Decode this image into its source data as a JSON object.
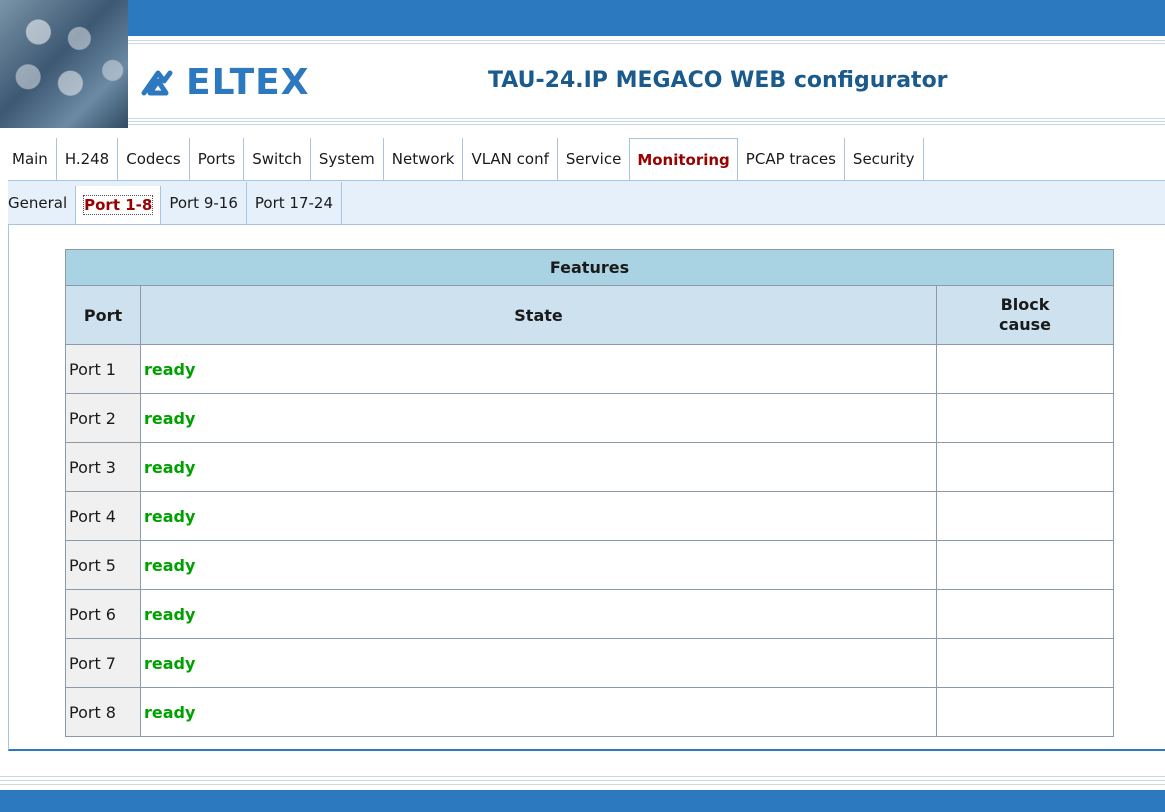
{
  "header": {
    "logo_text": "ELTEX",
    "app_title": "TAU-24.IP MEGACO WEB configurator"
  },
  "main_tabs": [
    {
      "label": "Main"
    },
    {
      "label": "H.248"
    },
    {
      "label": "Codecs"
    },
    {
      "label": "Ports"
    },
    {
      "label": "Switch"
    },
    {
      "label": "System"
    },
    {
      "label": "Network"
    },
    {
      "label": "VLAN conf"
    },
    {
      "label": "Service"
    },
    {
      "label": "Monitoring",
      "active": true
    },
    {
      "label": "PCAP traces"
    },
    {
      "label": "Security"
    }
  ],
  "sub_tabs": [
    {
      "label": "General"
    },
    {
      "label": "Port 1-8",
      "active": true
    },
    {
      "label": "Port 9-16"
    },
    {
      "label": "Port 17-24"
    }
  ],
  "table": {
    "caption": "Features",
    "headers": {
      "port": "Port",
      "state": "State",
      "block": "Block\ncause"
    },
    "rows": [
      {
        "port": "Port 1",
        "state": "ready",
        "block": ""
      },
      {
        "port": "Port 2",
        "state": "ready",
        "block": ""
      },
      {
        "port": "Port 3",
        "state": "ready",
        "block": ""
      },
      {
        "port": "Port 4",
        "state": "ready",
        "block": ""
      },
      {
        "port": "Port 5",
        "state": "ready",
        "block": ""
      },
      {
        "port": "Port 6",
        "state": "ready",
        "block": ""
      },
      {
        "port": "Port 7",
        "state": "ready",
        "block": ""
      },
      {
        "port": "Port 8",
        "state": "ready",
        "block": ""
      }
    ]
  },
  "colors": {
    "brand_blue": "#2c79c0",
    "active_tab_text": "#990000",
    "state_ready": "#00a000",
    "table_caption_bg": "#a9d3e2",
    "table_header_bg": "#cde1ee"
  }
}
